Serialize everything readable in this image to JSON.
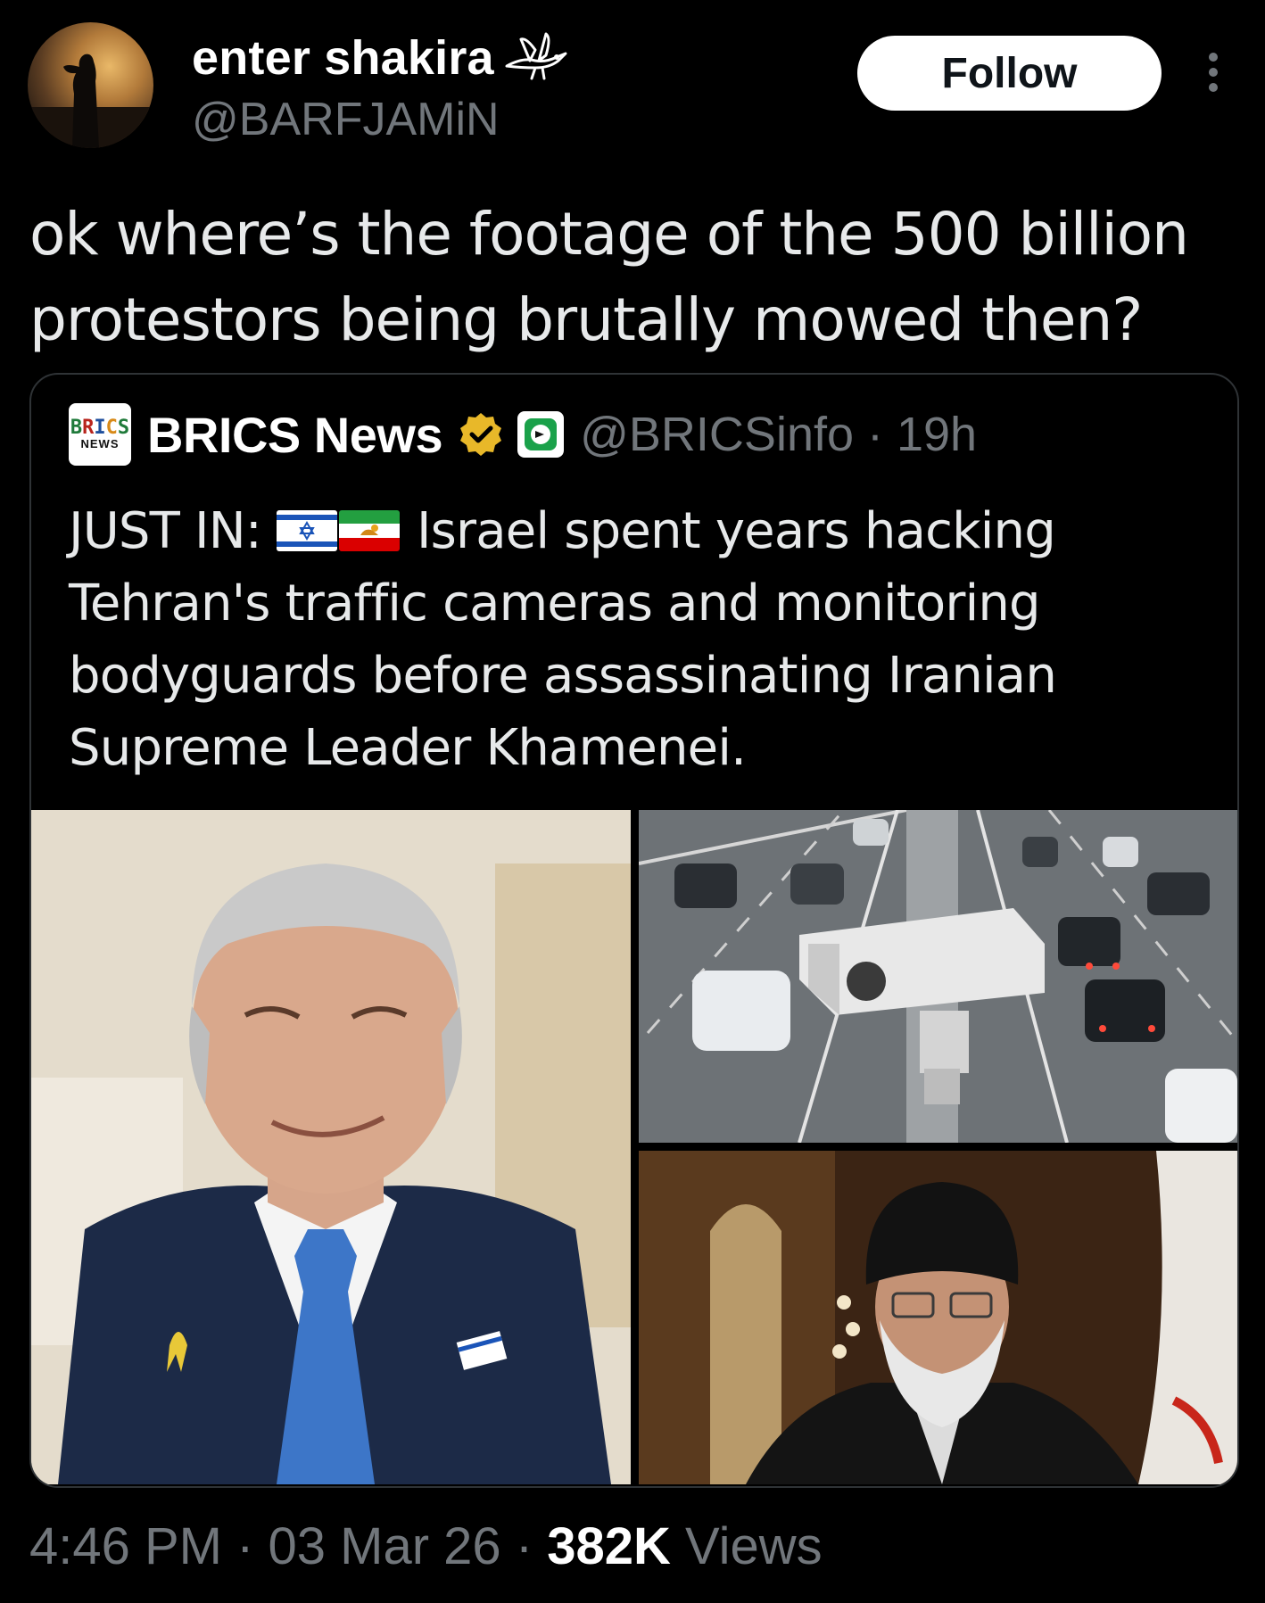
{
  "author": {
    "display_name": "enter shakira",
    "handle": "@BARFJAMiN",
    "name_icon": "bird-icon"
  },
  "header": {
    "follow_label": "Follow",
    "more_icon": "more-vertical-icon"
  },
  "tweet": {
    "text_line_1": "ok where’s the footage of the 500 billion",
    "text_line_2": "protestors being brutally mowed then?"
  },
  "quote": {
    "logo_line_1": "BRICS",
    "logo_line_2": "NEWS",
    "name": "BRICS News",
    "handle_time": "@BRICSinfo · 19h",
    "verified_icon": "verified-gold-badge-icon",
    "affiliate_icon": "affiliate-badge-icon",
    "text_prefix": "JUST IN:",
    "flags": [
      "israel-flag",
      "iran-lion-sun-flag"
    ],
    "text_line_1_rest": " Israel spent years hacking",
    "text_line_2": "Tehran's traffic cameras and monitoring",
    "text_line_3": "bodyguards before assassinating Iranian",
    "text_line_4": "Supreme Leader Khamenei.",
    "images": [
      "photo-smiling-man-in-suit",
      "photo-traffic-camera-over-highway",
      "photo-cleric-in-black-turban"
    ]
  },
  "meta": {
    "time": "4:46 PM",
    "sep1": " · ",
    "date": "03 Mar 26",
    "sep2": " · ",
    "views_count": "382K",
    "views_label": " Views"
  },
  "colors": {
    "background": "#000000",
    "primary_text": "#e7e9ea",
    "secondary_text": "#71767b",
    "border": "#2f3336",
    "follow_bg": "#ffffff",
    "verified_gold": "#e8b829"
  }
}
